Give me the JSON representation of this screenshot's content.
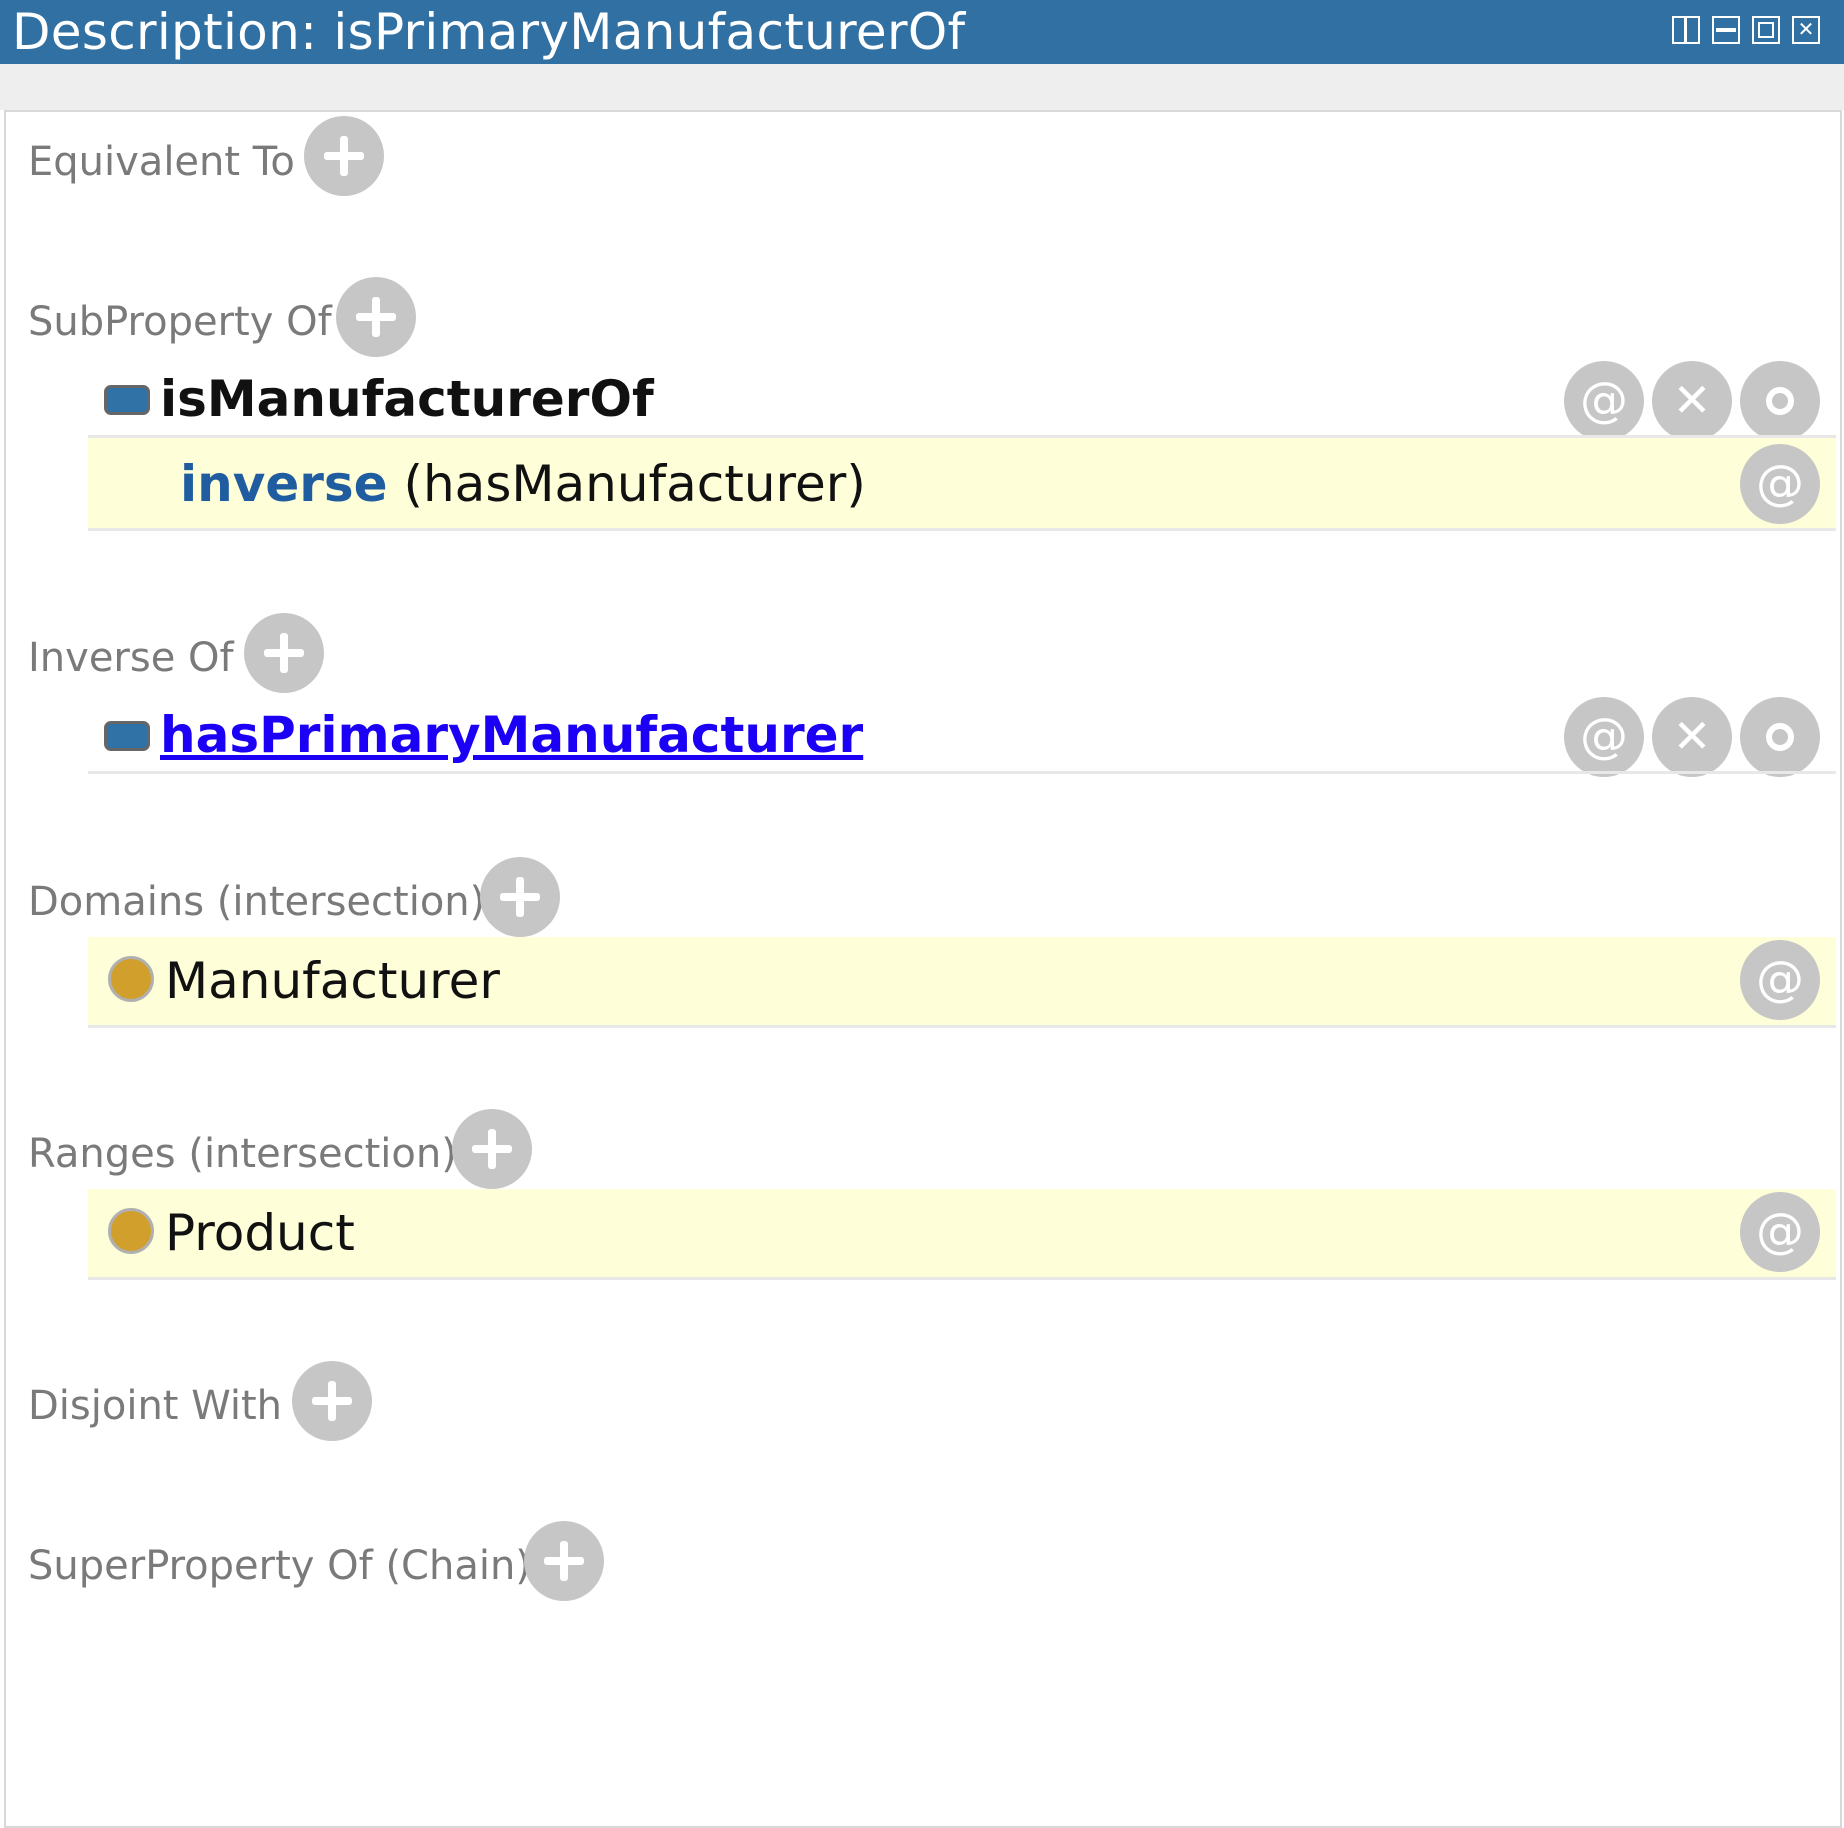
{
  "window": {
    "title": "Description: isPrimaryManufacturerOf",
    "controls": [
      "split-icon",
      "minimize-icon",
      "maximize-icon",
      "close-icon"
    ]
  },
  "sections": {
    "equivalent_to": {
      "label": "Equivalent To"
    },
    "subproperty_of": {
      "label": "SubProperty Of",
      "items": [
        {
          "name": "isManufacturerOf",
          "icon": "object-property-icon"
        },
        {
          "keyword": "inverse",
          "expression": "(hasManufacturer)"
        }
      ]
    },
    "inverse_of": {
      "label": "Inverse Of",
      "items": [
        {
          "name": "hasPrimaryManufacturer",
          "icon": "object-property-icon"
        }
      ]
    },
    "domains": {
      "label": "Domains (intersection)",
      "items": [
        {
          "name": "Manufacturer",
          "icon": "class-icon"
        }
      ]
    },
    "ranges": {
      "label": "Ranges (intersection)",
      "items": [
        {
          "name": "Product",
          "icon": "class-icon"
        }
      ]
    },
    "disjoint_with": {
      "label": "Disjoint With"
    },
    "superproperty_of_chain": {
      "label": "SuperProperty Of (Chain)"
    }
  },
  "buttons": {
    "annotate": "@",
    "delete": "✕"
  },
  "colors": {
    "title_bar": "#3170a3",
    "highlight_row": "#fefed9",
    "object_property": "#3172a6",
    "class": "#d19f2c",
    "link": "#1b00f5",
    "keyword": "#1f5ca0",
    "button": "#c6c6c6"
  }
}
